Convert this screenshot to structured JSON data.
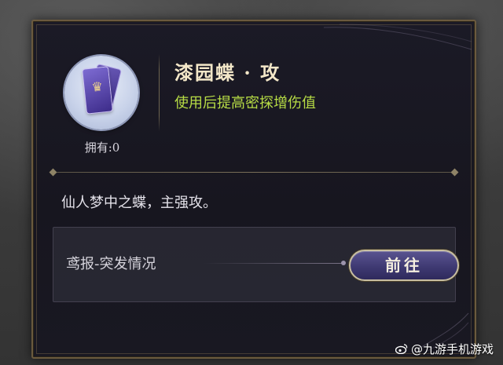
{
  "item": {
    "title": "漆园蝶 · 攻",
    "effect": "使用后提高密探增伤值",
    "owned_label": "拥有:0",
    "description": "仙人梦中之蝶，主强攻。",
    "card_icon": "purple-card-icon"
  },
  "source": {
    "label": "鸢报-突发情况",
    "goto_label": "前往"
  },
  "watermark": {
    "text": "@九游手机游戏"
  },
  "colors": {
    "title": "#f3e7c8",
    "effect": "#b7dc45",
    "panel_border": "#6b5a3e",
    "button_bg": "#3f3a73"
  }
}
